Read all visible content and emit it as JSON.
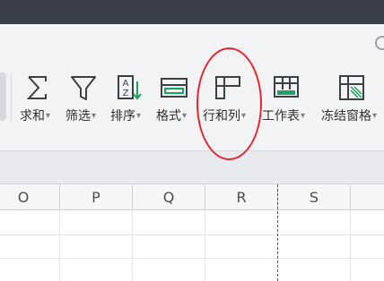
{
  "ribbon": {
    "tools": [
      {
        "label": "求和",
        "icon": "sigma-sum-icon"
      },
      {
        "label": "筛选",
        "icon": "funnel-filter-icon"
      },
      {
        "label": "排序",
        "icon": "sort-az-icon"
      },
      {
        "label": "格式",
        "icon": "format-table-icon"
      },
      {
        "label": "行和列",
        "icon": "rows-columns-icon"
      },
      {
        "label": "工作表",
        "icon": "worksheet-icon"
      },
      {
        "label": "冻结窗格",
        "icon": "freeze-panes-icon"
      }
    ],
    "caret": "▾",
    "highlighted": "行和列"
  },
  "columns": [
    "O",
    "P",
    "Q",
    "R",
    "S"
  ],
  "colors": {
    "titlebar": "#3b3f4b",
    "ribbon_bg": "#f2f3f5",
    "annotation": "#e8262d",
    "accent_green": "#1aa35a"
  }
}
